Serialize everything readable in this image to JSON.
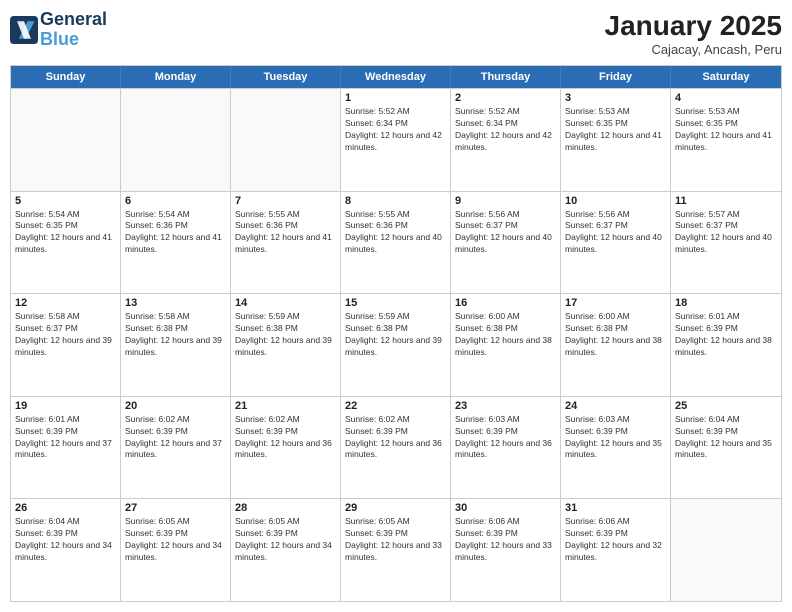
{
  "header": {
    "logo_line1": "General",
    "logo_line2": "Blue",
    "month_year": "January 2025",
    "location": "Cajacay, Ancash, Peru"
  },
  "day_headers": [
    "Sunday",
    "Monday",
    "Tuesday",
    "Wednesday",
    "Thursday",
    "Friday",
    "Saturday"
  ],
  "weeks": [
    [
      {
        "num": "",
        "sunrise": "",
        "sunset": "",
        "daylight": "",
        "empty": true
      },
      {
        "num": "",
        "sunrise": "",
        "sunset": "",
        "daylight": "",
        "empty": true
      },
      {
        "num": "",
        "sunrise": "",
        "sunset": "",
        "daylight": "",
        "empty": true
      },
      {
        "num": "1",
        "sunrise": "Sunrise: 5:52 AM",
        "sunset": "Sunset: 6:34 PM",
        "daylight": "Daylight: 12 hours and 42 minutes."
      },
      {
        "num": "2",
        "sunrise": "Sunrise: 5:52 AM",
        "sunset": "Sunset: 6:34 PM",
        "daylight": "Daylight: 12 hours and 42 minutes."
      },
      {
        "num": "3",
        "sunrise": "Sunrise: 5:53 AM",
        "sunset": "Sunset: 6:35 PM",
        "daylight": "Daylight: 12 hours and 41 minutes."
      },
      {
        "num": "4",
        "sunrise": "Sunrise: 5:53 AM",
        "sunset": "Sunset: 6:35 PM",
        "daylight": "Daylight: 12 hours and 41 minutes."
      }
    ],
    [
      {
        "num": "5",
        "sunrise": "Sunrise: 5:54 AM",
        "sunset": "Sunset: 6:35 PM",
        "daylight": "Daylight: 12 hours and 41 minutes."
      },
      {
        "num": "6",
        "sunrise": "Sunrise: 5:54 AM",
        "sunset": "Sunset: 6:36 PM",
        "daylight": "Daylight: 12 hours and 41 minutes."
      },
      {
        "num": "7",
        "sunrise": "Sunrise: 5:55 AM",
        "sunset": "Sunset: 6:36 PM",
        "daylight": "Daylight: 12 hours and 41 minutes."
      },
      {
        "num": "8",
        "sunrise": "Sunrise: 5:55 AM",
        "sunset": "Sunset: 6:36 PM",
        "daylight": "Daylight: 12 hours and 40 minutes."
      },
      {
        "num": "9",
        "sunrise": "Sunrise: 5:56 AM",
        "sunset": "Sunset: 6:37 PM",
        "daylight": "Daylight: 12 hours and 40 minutes."
      },
      {
        "num": "10",
        "sunrise": "Sunrise: 5:56 AM",
        "sunset": "Sunset: 6:37 PM",
        "daylight": "Daylight: 12 hours and 40 minutes."
      },
      {
        "num": "11",
        "sunrise": "Sunrise: 5:57 AM",
        "sunset": "Sunset: 6:37 PM",
        "daylight": "Daylight: 12 hours and 40 minutes."
      }
    ],
    [
      {
        "num": "12",
        "sunrise": "Sunrise: 5:58 AM",
        "sunset": "Sunset: 6:37 PM",
        "daylight": "Daylight: 12 hours and 39 minutes."
      },
      {
        "num": "13",
        "sunrise": "Sunrise: 5:58 AM",
        "sunset": "Sunset: 6:38 PM",
        "daylight": "Daylight: 12 hours and 39 minutes."
      },
      {
        "num": "14",
        "sunrise": "Sunrise: 5:59 AM",
        "sunset": "Sunset: 6:38 PM",
        "daylight": "Daylight: 12 hours and 39 minutes."
      },
      {
        "num": "15",
        "sunrise": "Sunrise: 5:59 AM",
        "sunset": "Sunset: 6:38 PM",
        "daylight": "Daylight: 12 hours and 39 minutes."
      },
      {
        "num": "16",
        "sunrise": "Sunrise: 6:00 AM",
        "sunset": "Sunset: 6:38 PM",
        "daylight": "Daylight: 12 hours and 38 minutes."
      },
      {
        "num": "17",
        "sunrise": "Sunrise: 6:00 AM",
        "sunset": "Sunset: 6:38 PM",
        "daylight": "Daylight: 12 hours and 38 minutes."
      },
      {
        "num": "18",
        "sunrise": "Sunrise: 6:01 AM",
        "sunset": "Sunset: 6:39 PM",
        "daylight": "Daylight: 12 hours and 38 minutes."
      }
    ],
    [
      {
        "num": "19",
        "sunrise": "Sunrise: 6:01 AM",
        "sunset": "Sunset: 6:39 PM",
        "daylight": "Daylight: 12 hours and 37 minutes."
      },
      {
        "num": "20",
        "sunrise": "Sunrise: 6:02 AM",
        "sunset": "Sunset: 6:39 PM",
        "daylight": "Daylight: 12 hours and 37 minutes."
      },
      {
        "num": "21",
        "sunrise": "Sunrise: 6:02 AM",
        "sunset": "Sunset: 6:39 PM",
        "daylight": "Daylight: 12 hours and 36 minutes."
      },
      {
        "num": "22",
        "sunrise": "Sunrise: 6:02 AM",
        "sunset": "Sunset: 6:39 PM",
        "daylight": "Daylight: 12 hours and 36 minutes."
      },
      {
        "num": "23",
        "sunrise": "Sunrise: 6:03 AM",
        "sunset": "Sunset: 6:39 PM",
        "daylight": "Daylight: 12 hours and 36 minutes."
      },
      {
        "num": "24",
        "sunrise": "Sunrise: 6:03 AM",
        "sunset": "Sunset: 6:39 PM",
        "daylight": "Daylight: 12 hours and 35 minutes."
      },
      {
        "num": "25",
        "sunrise": "Sunrise: 6:04 AM",
        "sunset": "Sunset: 6:39 PM",
        "daylight": "Daylight: 12 hours and 35 minutes."
      }
    ],
    [
      {
        "num": "26",
        "sunrise": "Sunrise: 6:04 AM",
        "sunset": "Sunset: 6:39 PM",
        "daylight": "Daylight: 12 hours and 34 minutes."
      },
      {
        "num": "27",
        "sunrise": "Sunrise: 6:05 AM",
        "sunset": "Sunset: 6:39 PM",
        "daylight": "Daylight: 12 hours and 34 minutes."
      },
      {
        "num": "28",
        "sunrise": "Sunrise: 6:05 AM",
        "sunset": "Sunset: 6:39 PM",
        "daylight": "Daylight: 12 hours and 34 minutes."
      },
      {
        "num": "29",
        "sunrise": "Sunrise: 6:05 AM",
        "sunset": "Sunset: 6:39 PM",
        "daylight": "Daylight: 12 hours and 33 minutes."
      },
      {
        "num": "30",
        "sunrise": "Sunrise: 6:06 AM",
        "sunset": "Sunset: 6:39 PM",
        "daylight": "Daylight: 12 hours and 33 minutes."
      },
      {
        "num": "31",
        "sunrise": "Sunrise: 6:06 AM",
        "sunset": "Sunset: 6:39 PM",
        "daylight": "Daylight: 12 hours and 32 minutes."
      },
      {
        "num": "",
        "sunrise": "",
        "sunset": "",
        "daylight": "",
        "empty": true
      }
    ]
  ]
}
